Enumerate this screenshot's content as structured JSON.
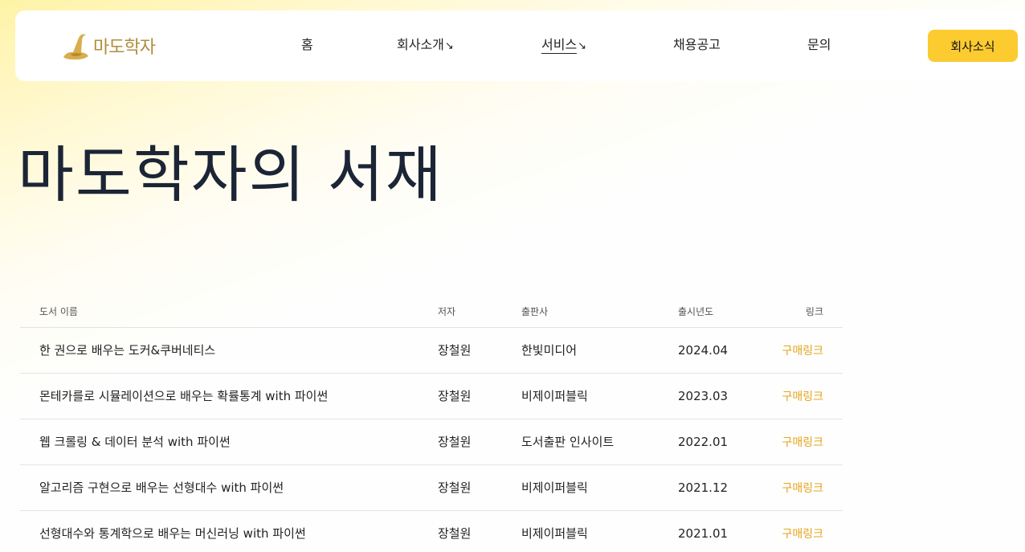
{
  "brand": {
    "name": "마도학자"
  },
  "nav": {
    "items": [
      {
        "label": "홈",
        "arrow": ""
      },
      {
        "label": "회사소개",
        "arrow": "↘"
      },
      {
        "label": "서비스",
        "arrow": "↘"
      },
      {
        "label": "채용공고",
        "arrow": ""
      },
      {
        "label": "문의",
        "arrow": ""
      }
    ],
    "active": "서비스",
    "news_button": "회사소식"
  },
  "hero": {
    "title": "마도학자의 서재"
  },
  "colors": {
    "accent": "#fbcb30",
    "link": "#e5a41c",
    "logo": "#c9a24a"
  },
  "table": {
    "headers": {
      "title": "도서 이름",
      "author": "저자",
      "publisher": "출판사",
      "year": "출시년도",
      "link": "링크"
    },
    "rows": [
      {
        "title": "한 권으로 배우는 도커&쿠버네티스",
        "author": "장철원",
        "publisher": "한빛미디어",
        "year": "2024.04",
        "link": "구매링크"
      },
      {
        "title": "몬테카를로 시뮬레이션으로 배우는 확률통계 with 파이썬",
        "author": "장철원",
        "publisher": "비제이퍼블릭",
        "year": "2023.03",
        "link": "구매링크"
      },
      {
        "title": "웹 크롤링 & 데이터 분석 with 파이썬",
        "author": "장철원",
        "publisher": "도서출판 인사이트",
        "year": "2022.01",
        "link": "구매링크"
      },
      {
        "title": "알고리즘 구현으로 배우는 선형대수 with 파이썬",
        "author": "장철원",
        "publisher": "비제이퍼블릭",
        "year": "2021.12",
        "link": "구매링크"
      },
      {
        "title": "선형대수와 통계학으로 배우는 머신러닝 with 파이썬",
        "author": "장철원",
        "publisher": "비제이퍼블릭",
        "year": "2021.01",
        "link": "구매링크"
      }
    ]
  }
}
